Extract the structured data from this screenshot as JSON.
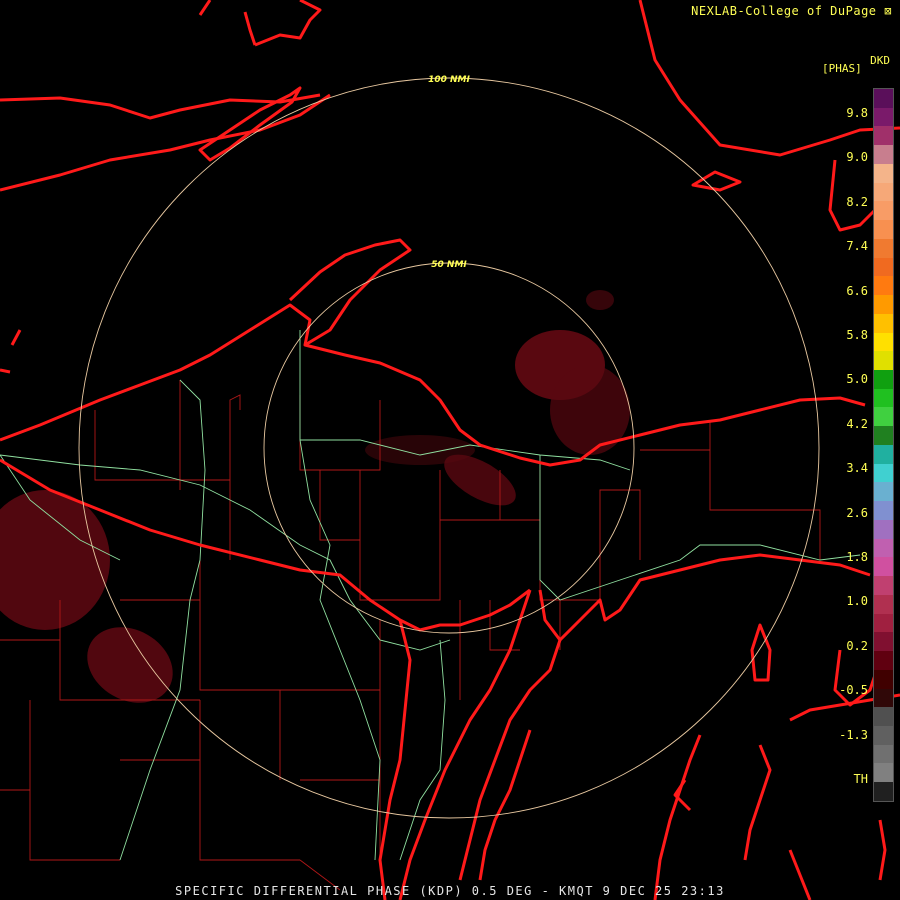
{
  "credit": "NEXLAB-College of DuPage",
  "legend": {
    "product_code": "DKD",
    "unit": "[PHAS]",
    "ticks": [
      "9.8",
      "9.0",
      "8.2",
      "7.4",
      "6.6",
      "5.8",
      "5.0",
      "4.2",
      "3.4",
      "2.6",
      "1.8",
      "1.0",
      "0.2",
      "-0.5",
      "-1.3",
      "TH"
    ],
    "colors": [
      "#5a0f5a",
      "#7a1a6a",
      "#a0306a",
      "#c87e8e",
      "#f4b48a",
      "#f6a878",
      "#f89c66",
      "#f89050",
      "#f07a30",
      "#f06a20",
      "#ff7a10",
      "#ff9a00",
      "#ffc000",
      "#ffe000",
      "#e0e000",
      "#10a010",
      "#20c020",
      "#40d040",
      "#208020",
      "#20b0a0",
      "#40d0d0",
      "#6ab0d0",
      "#8090d0",
      "#a070c0",
      "#c060b0",
      "#d050a0",
      "#c04070",
      "#b03050",
      "#a02040",
      "#801030",
      "#600010",
      "#400000",
      "#300808",
      "#505050",
      "#606060",
      "#707070",
      "#808080",
      "#202020"
    ]
  },
  "rings": [
    {
      "label": "100 NMI"
    },
    {
      "label": "50 NMI"
    }
  ],
  "caption": "SPECIFIC DIFFERENTIAL PHASE (KDP) 0.5 DEG - KMQT 9 DEC 25 23:13",
  "colors": {
    "background": "#000000",
    "state_border": "#ff1a1a",
    "county_border": "#cc2222",
    "road": "#90e0a0",
    "ring": "#e8c8a0",
    "echo": "#6a0a14"
  }
}
